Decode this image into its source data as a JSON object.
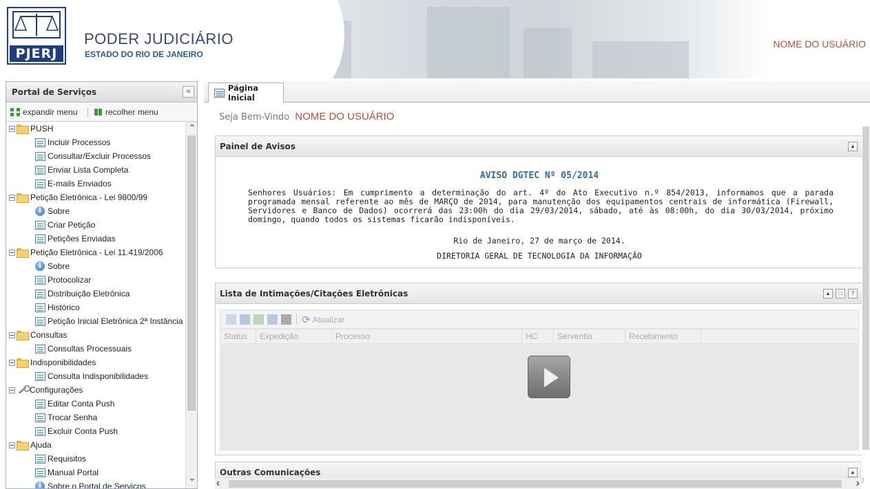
{
  "header": {
    "logo_text": "PJERJ",
    "org_title": "PODER JUDICIÁRIO",
    "org_subtitle": "ESTADO DO RIO DE JANEIRO",
    "user_name": "NOME DO USUÁRIO"
  },
  "sidebar": {
    "title": "Portal de Serviços",
    "collapse_glyph": "«",
    "expand_label": "expandir menu",
    "collapse_label": "recolher menu",
    "tree": [
      {
        "label": "PUSH",
        "kind": "folder"
      },
      {
        "label": "Incluir Processos",
        "kind": "doc"
      },
      {
        "label": "Consultar/Excluir Processos",
        "kind": "doc"
      },
      {
        "label": "Enviar Lista Completa",
        "kind": "doc"
      },
      {
        "label": "E-mails Enviados",
        "kind": "doc"
      },
      {
        "label": "Petição Eletrônica - Lei 9800/99",
        "kind": "folder"
      },
      {
        "label": "Sobre",
        "kind": "info"
      },
      {
        "label": "Criar Petição",
        "kind": "doc"
      },
      {
        "label": "Petições Enviadas",
        "kind": "doc"
      },
      {
        "label": "Petição Eletrônica - Lei 11.419/2006",
        "kind": "folder"
      },
      {
        "label": "Sobre",
        "kind": "info"
      },
      {
        "label": "Protocolizar",
        "kind": "doc"
      },
      {
        "label": "Distribuição Eletrônica",
        "kind": "doc"
      },
      {
        "label": "Histórico",
        "kind": "doc"
      },
      {
        "label": "Petição Inicial Eletrônica 2ª Instância",
        "kind": "doc"
      },
      {
        "label": "Consultas",
        "kind": "folder"
      },
      {
        "label": "Consultas Processuais",
        "kind": "doc"
      },
      {
        "label": "Indisponibilidades",
        "kind": "folder"
      },
      {
        "label": "Consulta Indisponibilidades",
        "kind": "doc"
      },
      {
        "label": "Configurações",
        "kind": "config"
      },
      {
        "label": "Editar Conta Push",
        "kind": "doc"
      },
      {
        "label": "Trocar Senha",
        "kind": "doc"
      },
      {
        "label": "Excluir Conta Push",
        "kind": "doc"
      },
      {
        "label": "Ajuda",
        "kind": "folder"
      },
      {
        "label": "Requisitos",
        "kind": "doc"
      },
      {
        "label": "Manual Portal",
        "kind": "doc"
      },
      {
        "label": "Sobre o Portal de Serviços",
        "kind": "info"
      }
    ]
  },
  "main": {
    "tab_label": "Página Inicial",
    "welcome_prefix": "Seja Bem-Vindo",
    "welcome_name": "NOME DO USUÁRIO",
    "avisos": {
      "title": "Painel de Avisos",
      "heading": "AVISO DGTEC Nº 05/2014",
      "body": "Senhores Usuários: Em cumprimento a determinação do art. 4º do Ato Executivo n.º 854/2013, informamos que a parada programada mensal referente ao mês de MARÇO de 2014, para manutenção dos equipamentos centrais de informática (Firewall, Servidores e Banco de Dados) ocorrerá das 23:00h do dia 29/03/2014, sábado, até às 08:00h, do dia 30/03/2014, próximo domingo, quando todos os sistemas ficarão indisponíveis.",
      "place_date": "Rio de Janeiro, 27 de março de 2014.",
      "signature": "DIRETORIA GERAL DE TECNOLOGIA DA INFORMAÇÃO"
    },
    "intimacoes": {
      "title": "Lista de Intimações/Citações Eletrônicas",
      "refresh_label": "Atualizar",
      "columns": [
        "Status",
        "Expedição",
        "Processo",
        "HC",
        "Serventia",
        "Recebimento"
      ]
    },
    "outras": {
      "title": "Outras Comunicações"
    }
  }
}
